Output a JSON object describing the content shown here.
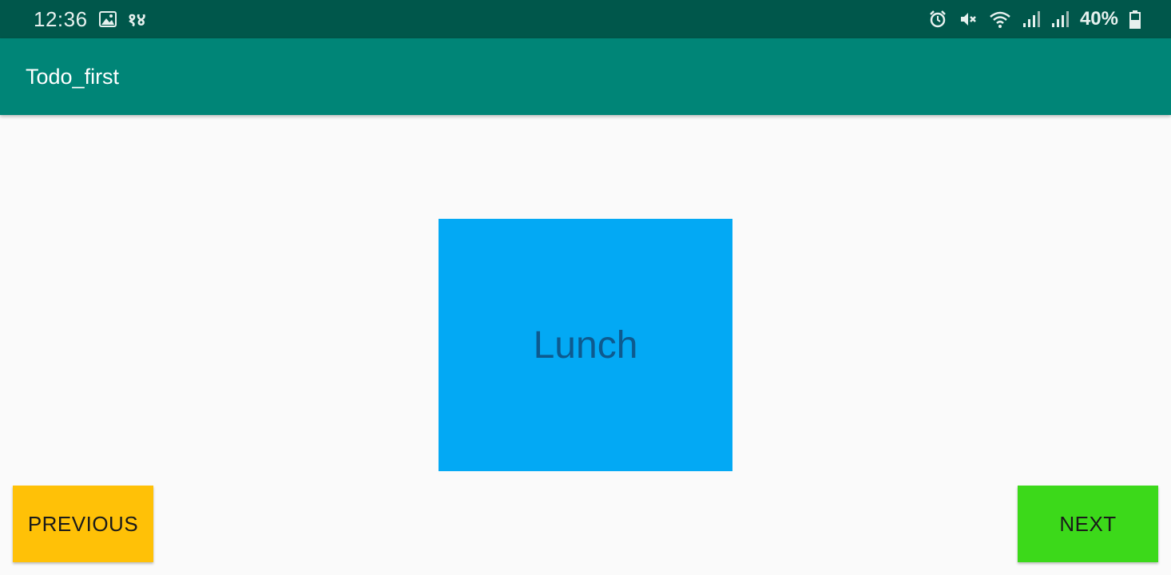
{
  "status_bar": {
    "time": "12:36",
    "left_icons": [
      "image-icon"
    ],
    "extra_text": "१४",
    "right_icons": [
      "alarm-icon",
      "mute-icon",
      "wifi-icon",
      "signal-icon",
      "signal-icon"
    ],
    "battery_percent": "40%",
    "colors": {
      "background": "#00574b"
    }
  },
  "app_bar": {
    "title": "Todo_first",
    "colors": {
      "background": "#008577"
    }
  },
  "card": {
    "label": "Lunch",
    "colors": {
      "background": "#03a9f4",
      "text": "#0d5a8f"
    }
  },
  "buttons": {
    "previous": {
      "label": "PREVIOUS",
      "color": "#ffc107"
    },
    "next": {
      "label": "NEXT",
      "color": "#3cd91a"
    }
  }
}
